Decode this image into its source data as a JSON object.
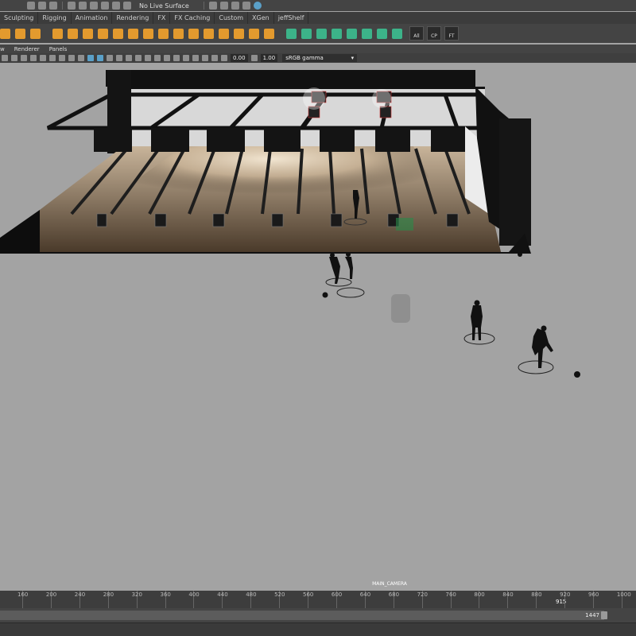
{
  "status_line": {
    "live_surface": "No Live Surface"
  },
  "shelf_tabs": [
    "Sculpting",
    "Rigging",
    "Animation",
    "Rendering",
    "FX",
    "FX Caching",
    "Custom",
    "XGen",
    "jeffShelf"
  ],
  "shelf_badges": [
    "All",
    "CP",
    "FT"
  ],
  "panel_menu": [
    "w",
    "Renderer",
    "Panels"
  ],
  "panel_toolbar": {
    "exposure": "0.00",
    "gamma": "1.00",
    "color_space": "sRGB gamma"
  },
  "viewport": {
    "camera": "MAIN_CAMERA"
  },
  "timeline": {
    "ticks": [
      "160",
      "200",
      "240",
      "280",
      "320",
      "360",
      "400",
      "440",
      "480",
      "520",
      "560",
      "600",
      "640",
      "680",
      "720",
      "760",
      "800",
      "840",
      "880",
      "920",
      "960",
      "1000"
    ],
    "current_frame": "915"
  },
  "range": {
    "end": "1447"
  },
  "colors": {
    "shelf_green": "#3cb389",
    "shelf_orange": "#e39a2e",
    "active_blue": "#5aa0c8",
    "viewport_bg": "#a3a3a3"
  }
}
